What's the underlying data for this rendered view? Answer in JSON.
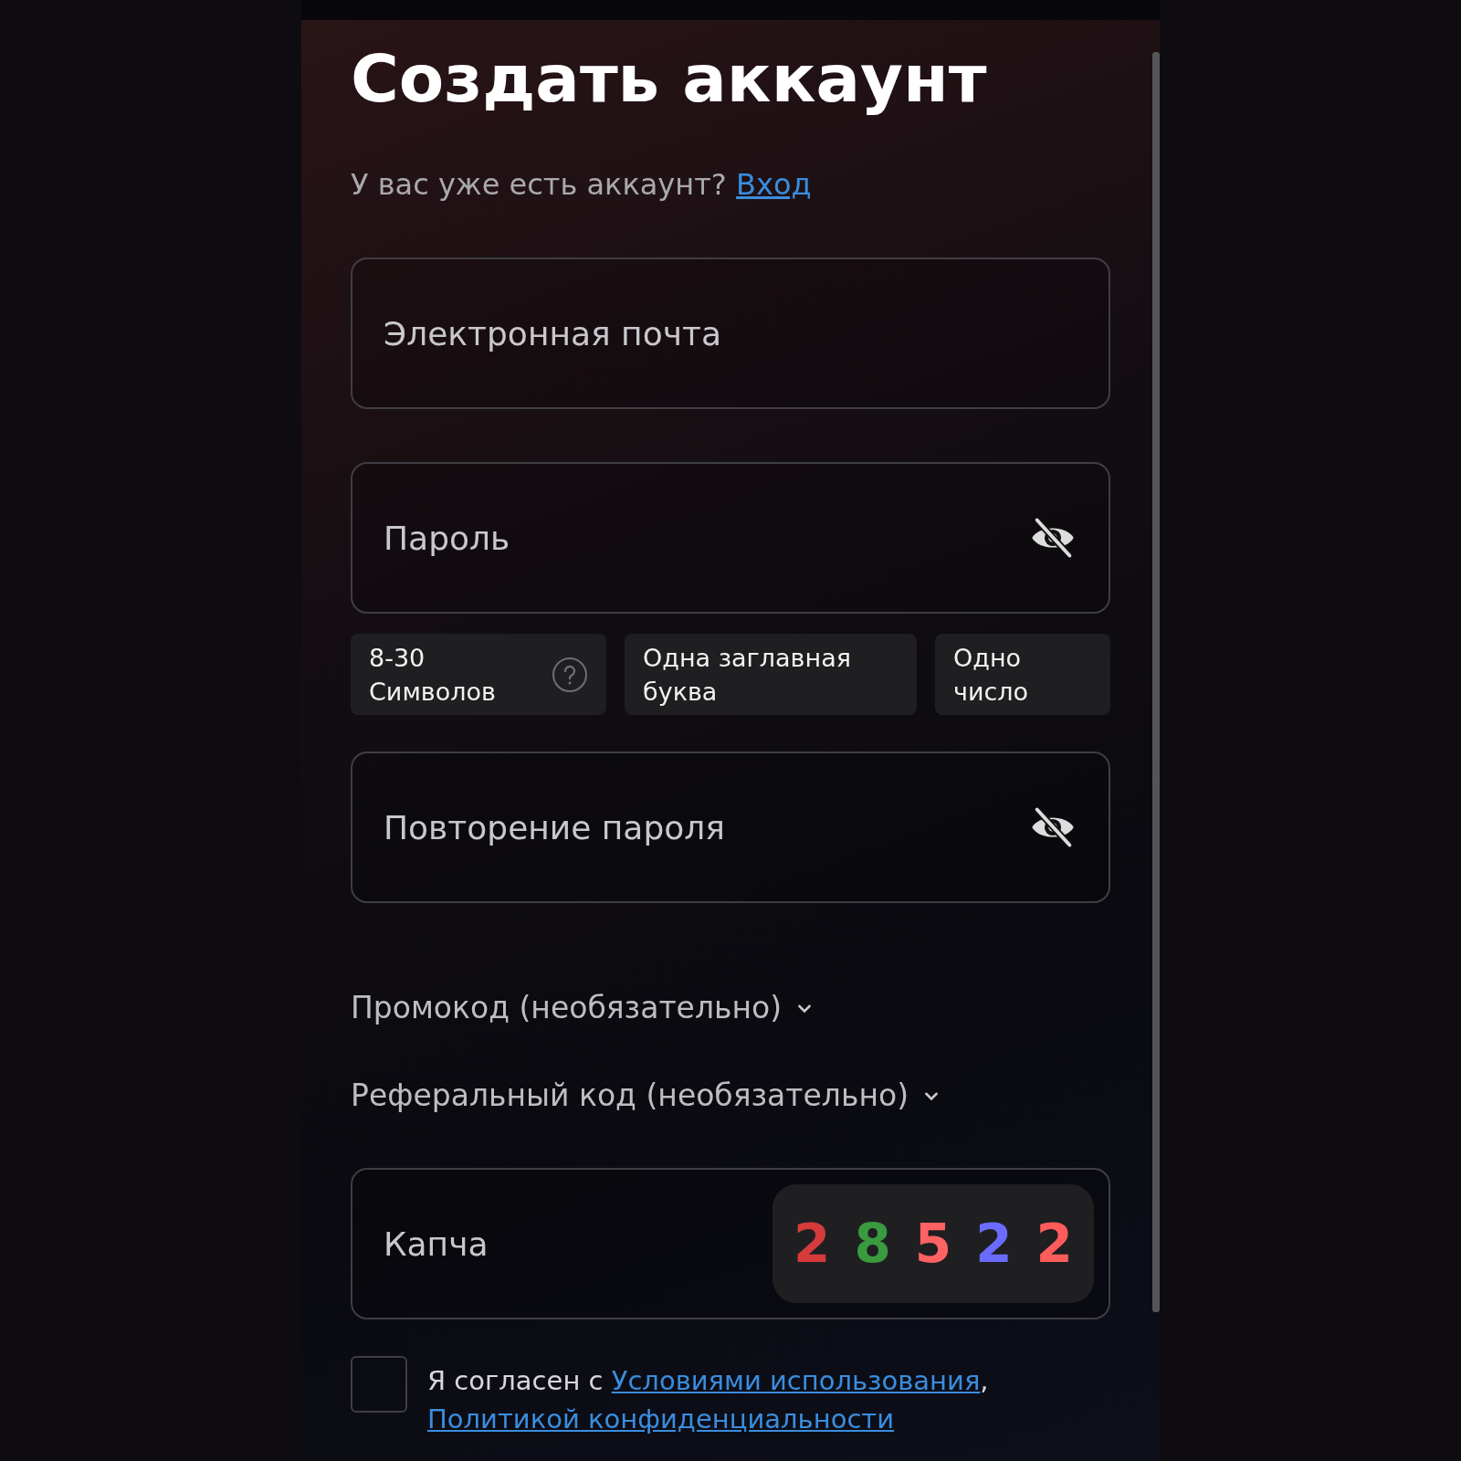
{
  "title": "Создать аккаунт",
  "login_prompt": {
    "text": "У вас уже есть аккаунт?",
    "link": "Вход"
  },
  "fields": [
    {
      "kind": "text",
      "placeholder": "Электронная почта"
    },
    {
      "kind": "password",
      "placeholder": "Пароль"
    },
    {
      "kind": "hints",
      "items": [
        {
          "label": "8-30 Символов",
          "help": true
        },
        {
          "label": "Одна заглавная буква",
          "help": false
        },
        {
          "label": "Одно число",
          "help": false
        }
      ]
    },
    {
      "kind": "password",
      "placeholder": "Повторение пароля"
    }
  ],
  "optional_sections": [
    {
      "label": "Промокод (необязательно)",
      "expanded": false
    },
    {
      "label": "Реферальный код (необязательно)",
      "expanded": false
    }
  ],
  "captcha": {
    "placeholder": "Капча",
    "digits": [
      {
        "text": "2",
        "color": "#d63b3b"
      },
      {
        "text": "8",
        "color": "#3a9a3e"
      },
      {
        "text": "5",
        "color": "#ff6262"
      },
      {
        "text": "2",
        "color": "#6b6bff"
      },
      {
        "text": "2",
        "color": "#ff5c5c"
      }
    ]
  },
  "agreement": {
    "checked": false,
    "text": "Я согласен с",
    "link": "Условиями использования",
    "after": ",",
    "link_2": "Политикой конфиденциальности"
  }
}
